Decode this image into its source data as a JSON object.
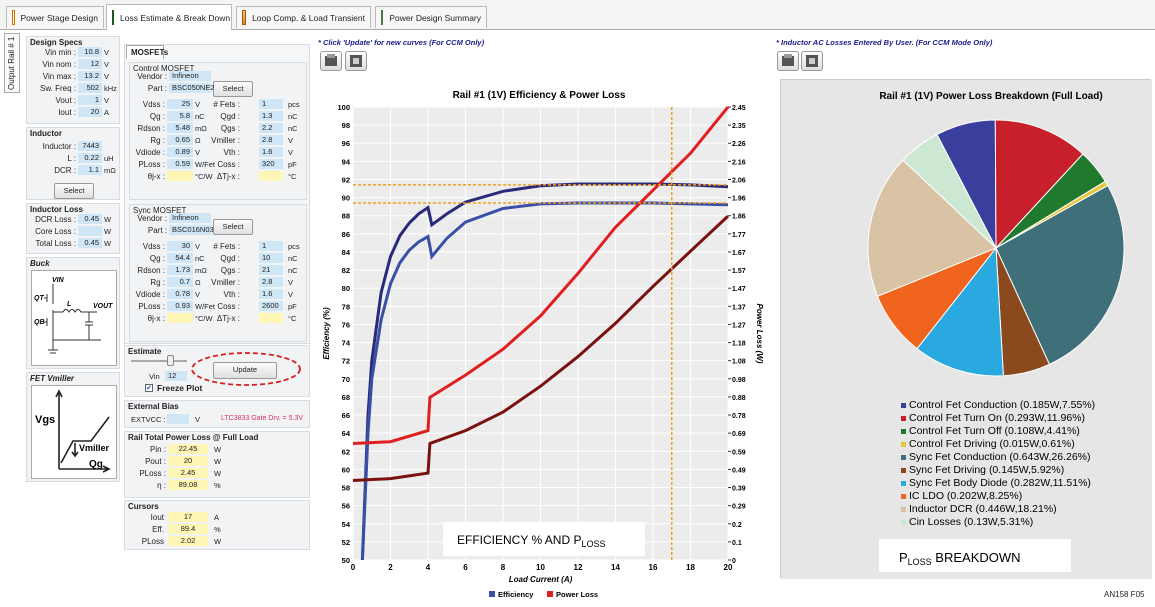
{
  "tabs": [
    {
      "label": "Power Stage Design",
      "active": false
    },
    {
      "label": "Loss Estimate & Break Down",
      "active": true
    },
    {
      "label": "Loop Comp. & Load Transient",
      "active": false
    },
    {
      "label": "Power Design Summary",
      "active": false
    }
  ],
  "side_tab": "Output Rail # 1",
  "design_specs": {
    "title": "Design Specs",
    "rows": [
      {
        "label": "Vin min :",
        "value": "10.8",
        "unit": "V"
      },
      {
        "label": "Vin nom :",
        "value": "12",
        "unit": "V"
      },
      {
        "label": "Vin max :",
        "value": "13.2",
        "unit": "V"
      },
      {
        "label": "Sw. Freq :",
        "value": "502",
        "unit": "kHz"
      },
      {
        "label": "Vout :",
        "value": "1",
        "unit": "V"
      },
      {
        "label": "Iout :",
        "value": "20",
        "unit": "A"
      }
    ]
  },
  "inductor": {
    "title": "Inductor",
    "rows": [
      {
        "label": "Inductor :",
        "value": "7443",
        "unit": ""
      },
      {
        "label": "L :",
        "value": "0.22",
        "unit": "uH"
      },
      {
        "label": "DCR :",
        "value": "1.1",
        "unit": "mΩ"
      }
    ],
    "select_label": "Select"
  },
  "inductor_loss": {
    "title": "Inductor Loss",
    "rows": [
      {
        "label": "DCR Loss :",
        "value": "0.45",
        "unit": "W"
      },
      {
        "label": "Core Loss :",
        "value": "",
        "unit": "W"
      },
      {
        "label": "Total Loss :",
        "value": "0.45",
        "unit": "W"
      }
    ]
  },
  "buck": {
    "title": "Buck",
    "labels": {
      "vin": "VIN",
      "qt": "QT",
      "qb": "QB",
      "l": "L",
      "vout": "VOUT"
    }
  },
  "fet_vmiller": {
    "title": "FET Vmiller",
    "labels": {
      "vgs": "Vgs",
      "vmiller": "Vmiller",
      "qg": "Qg"
    }
  },
  "mosfets": {
    "tab": "MOSFETs",
    "control": {
      "title": "Control MOSFET",
      "vendor_label": "Vendor :",
      "vendor": "Infineon",
      "part_label": "Part :",
      "part": "BSC050NE2",
      "select_label": "Select",
      "left": [
        {
          "label": "Vdss :",
          "value": "25",
          "unit": "V"
        },
        {
          "label": "Qg :",
          "value": "5.8",
          "unit": "nC"
        },
        {
          "label": "Rdson :",
          "value": "5.48",
          "unit": "mΩ"
        },
        {
          "label": "Rg :",
          "value": "0.65",
          "unit": "Ω"
        },
        {
          "label": "Vdiode :",
          "value": "0.89",
          "unit": "V"
        },
        {
          "label": "PLoss :",
          "value": "0.59",
          "unit": "W/Fet"
        },
        {
          "label": "θj-x :",
          "value": "",
          "unit": "°C/W"
        }
      ],
      "right": [
        {
          "label": "# Fets :",
          "value": "1",
          "unit": "pcs"
        },
        {
          "label": "Qgd :",
          "value": "1.3",
          "unit": "nC"
        },
        {
          "label": "Qgs :",
          "value": "2.2",
          "unit": "nC"
        },
        {
          "label": "Vmiller :",
          "value": "2.8",
          "unit": "V"
        },
        {
          "label": "Vth :",
          "value": "1.6",
          "unit": "V"
        },
        {
          "label": "Coss :",
          "value": "320",
          "unit": "pF"
        },
        {
          "label": "ΔTj-x :",
          "value": "",
          "unit": "°C"
        }
      ]
    },
    "sync": {
      "title": "Sync MOSFET",
      "vendor_label": "Vendor :",
      "vendor": "Infineon",
      "part_label": "Part :",
      "part": "BSC016N03",
      "select_label": "Select",
      "left": [
        {
          "label": "Vdss :",
          "value": "30",
          "unit": "V"
        },
        {
          "label": "Qg :",
          "value": "54.4",
          "unit": "nC"
        },
        {
          "label": "Rdson :",
          "value": "1.73",
          "unit": "mΩ"
        },
        {
          "label": "Rg :",
          "value": "0.7",
          "unit": "Ω"
        },
        {
          "label": "Vdiode :",
          "value": "0.78",
          "unit": "V"
        },
        {
          "label": "PLoss :",
          "value": "0.93",
          "unit": "W/Fet"
        },
        {
          "label": "θj-x :",
          "value": "",
          "unit": "°C/W"
        }
      ],
      "right": [
        {
          "label": "# Fets :",
          "value": "1",
          "unit": "pcs"
        },
        {
          "label": "Qgd :",
          "value": "10",
          "unit": "nC"
        },
        {
          "label": "Qgs :",
          "value": "21",
          "unit": "nC"
        },
        {
          "label": "Vmiller :",
          "value": "2.8",
          "unit": "V"
        },
        {
          "label": "Vth :",
          "value": "1.6",
          "unit": "V"
        },
        {
          "label": "Coss :",
          "value": "2600",
          "unit": "pF"
        },
        {
          "label": "ΔTj-x :",
          "value": "",
          "unit": "°C"
        }
      ]
    }
  },
  "estimate": {
    "title": "Estimate",
    "vin_label": "Vin",
    "vin": "12",
    "update_label": "Update",
    "freeze_label": "Freeze Plot",
    "freeze_checked": true
  },
  "external_bias": {
    "title": "External Bias",
    "label": "EXTVCC :",
    "value": "",
    "unit": "V",
    "note": "LTC3833 Gate Drv. = 5.3V"
  },
  "rail_total": {
    "title": "Rail Total Power Loss @ Full Load",
    "rows": [
      {
        "label": "Pin :",
        "value": "22.45",
        "unit": "W"
      },
      {
        "label": "Pout :",
        "value": "20",
        "unit": "W"
      },
      {
        "label": "PLoss :",
        "value": "2.45",
        "unit": "W"
      },
      {
        "label": "η :",
        "value": "89.08",
        "unit": "%"
      }
    ]
  },
  "cursors": {
    "title": "Cursors",
    "rows": [
      {
        "label": "Iout",
        "value": "17",
        "unit": "A"
      },
      {
        "label": "Eff.",
        "value": "89.4",
        "unit": "%"
      },
      {
        "label": "PLoss",
        "value": "2.02",
        "unit": "W"
      }
    ]
  },
  "hints": {
    "left": "* Click 'Update' for new curves (For CCM Only)",
    "right": "* Inductor AC Losses Entered By User. (For CCM Mode Only)"
  },
  "annot": {
    "eff": "EFFICIENCY % AND P",
    "eff_sub": "LOSS",
    "pie": "P",
    "pie_sub": "LOSS",
    "pie_tail": " BREAKDOWN",
    "fig": "AN158 F05"
  },
  "chart_data": [
    {
      "type": "line",
      "title": "Rail #1 (1V) Efficiency & Power Loss",
      "xlabel": "Load Current (A)",
      "ylabel": "Efficiency (%)",
      "y2label": "Power Loss (W)",
      "xlim": [
        0,
        20
      ],
      "ylim": [
        50,
        100
      ],
      "y2lim": [
        0,
        2.45
      ],
      "xticks": [
        0,
        2,
        4,
        6,
        8,
        10,
        12,
        14,
        16,
        18,
        20
      ],
      "yticks": [
        50,
        52,
        54,
        56,
        58,
        60,
        62,
        64,
        66,
        68,
        70,
        72,
        74,
        76,
        78,
        80,
        82,
        84,
        86,
        88,
        90,
        92,
        94,
        96,
        98,
        100
      ],
      "y2ticks": [
        "0",
        "0.1",
        "0.2",
        "0.29",
        "0.39",
        "0.49",
        "0.59",
        "0.69",
        "0.78",
        "0.88",
        "0.98",
        "1.08",
        "1.18",
        "1.27",
        "1.37",
        "1.47",
        "1.57",
        "1.67",
        "1.77",
        "1.86",
        "1.96",
        "2.06",
        "2.16",
        "2.26",
        "2.35",
        "2.45"
      ],
      "legend": [
        {
          "name": "Efficiency",
          "color": "#3a4fa8"
        },
        {
          "name": "Power Loss",
          "color": "#e02020"
        }
      ],
      "series": [
        {
          "name": "Efficiency",
          "color": "#2a2a7a",
          "x": [
            0.5,
            0.8,
            1,
            1.5,
            2,
            2.5,
            3,
            3.5,
            4,
            4.2,
            5,
            6,
            8,
            10,
            12,
            14,
            16,
            18,
            20
          ],
          "y": [
            50,
            66,
            72,
            79.5,
            83.5,
            85.8,
            87.2,
            88.2,
            88.9,
            87,
            88.2,
            89.5,
            90.7,
            91.3,
            91.5,
            91.5,
            91.5,
            91.4,
            91.2
          ]
        },
        {
          "name": "Efficiency",
          "color": "#3a4fa8",
          "x": [
            0.5,
            0.8,
            1,
            1.5,
            2,
            2.5,
            3,
            3.5,
            4,
            4.2,
            5,
            6,
            8,
            10,
            12,
            14,
            16,
            18,
            20
          ],
          "y": [
            50,
            64,
            70,
            76.5,
            80.5,
            82.8,
            84.2,
            85.1,
            85.7,
            83.5,
            85.5,
            87.3,
            88.8,
            89.3,
            89.4,
            89.4,
            89.4,
            89.3,
            89.2
          ]
        },
        {
          "name": "Power Loss",
          "color": "#e02020",
          "x": [
            0,
            2,
            4,
            4.1,
            6,
            8,
            10,
            12,
            14,
            16,
            18,
            20
          ],
          "y": [
            0.63,
            0.64,
            0.7,
            0.88,
            1.0,
            1.14,
            1.32,
            1.55,
            1.8,
            2.0,
            2.2,
            2.45
          ]
        },
        {
          "name": "Power Loss",
          "color": "#7a1010",
          "x": [
            0,
            2,
            4,
            4.1,
            6,
            8,
            10,
            12,
            14,
            16,
            18,
            20
          ],
          "y": [
            0.43,
            0.44,
            0.47,
            0.63,
            0.7,
            0.8,
            0.94,
            1.1,
            1.28,
            1.48,
            1.67,
            1.86
          ]
        }
      ],
      "cursor": {
        "x": 17,
        "eff": 89.4,
        "eff_hi": 91.4
      }
    },
    {
      "type": "pie",
      "title": "Rail #1 (1V) Power Loss Breakdown (Full Load)",
      "slices": [
        {
          "label": "Control Fet Conduction (0.185W,7.55%)",
          "value": 7.55,
          "color": "#3a3f9e"
        },
        {
          "label": "Control Fet Turn On (0.293W,11.96%)",
          "value": 11.96,
          "color": "#c8202a"
        },
        {
          "label": "Control Fet Turn Off (0.108W,4.41%)",
          "value": 4.41,
          "color": "#1f7a2e"
        },
        {
          "label": "Control Fet Driving (0.015W,0.61%)",
          "value": 0.61,
          "color": "#e8c63a"
        },
        {
          "label": "Sync Fet Conduction (0.643W,26.26%)",
          "value": 26.26,
          "color": "#3f6f78"
        },
        {
          "label": "Sync Fet Driving (0.145W,5.92%)",
          "value": 5.92,
          "color": "#8a4a1e"
        },
        {
          "label": "Sync Fet Body Diode (0.282W,11.51%)",
          "value": 11.51,
          "color": "#2aa8e0"
        },
        {
          "label": "IC LDO (0.202W,8.25%)",
          "value": 8.25,
          "color": "#f0641e"
        },
        {
          "label": "Inductor DCR (0.446W,18.21%)",
          "value": 18.21,
          "color": "#d8c4a4"
        },
        {
          "label": "Cin Losses (0.13W,5.31%)",
          "value": 5.31,
          "color": "#cde8d2"
        }
      ]
    }
  ]
}
